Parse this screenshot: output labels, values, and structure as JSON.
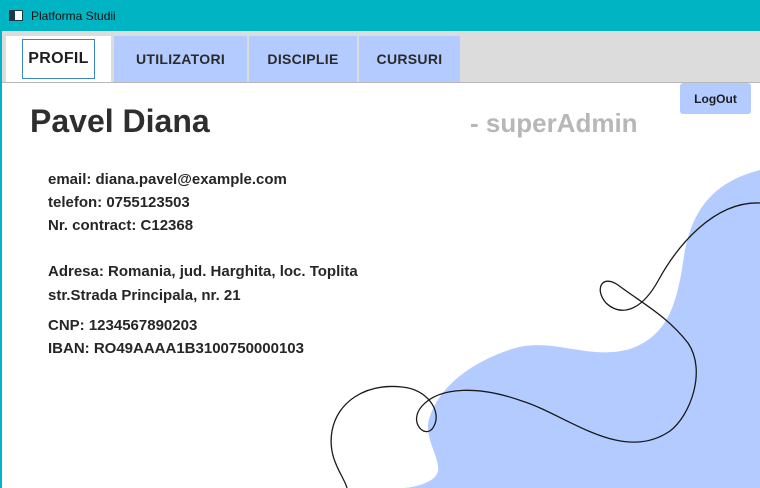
{
  "window": {
    "title": "Platforma Studii"
  },
  "tabs": [
    {
      "label": "PROFIL",
      "active": true
    },
    {
      "label": "UTILIZATORI",
      "active": false
    },
    {
      "label": "DISCIPLIE",
      "active": false
    },
    {
      "label": "CURSURI",
      "active": false
    }
  ],
  "header": {
    "logout_label": "LogOut"
  },
  "profile": {
    "name": "Pavel Diana",
    "role": "- superAdmin",
    "email": "email: diana.pavel@example.com",
    "phone": "telefon: 0755123503",
    "contract": "Nr. contract: C12368",
    "address_line1": "Adresa: Romania, jud. Harghita, loc. Toplita",
    "address_line2": "str.Strada Principala, nr. 21",
    "cnp": "CNP: 1234567890203",
    "iban": "IBAN: RO49AAAA1B3100750000103"
  },
  "colors": {
    "titlebar": "#00b4c4",
    "tab_accent": "#b3cbff",
    "decor_blob": "#b3cbff",
    "role_text": "#b7b7b7"
  },
  "icons": {
    "app": "window-app-icon"
  }
}
